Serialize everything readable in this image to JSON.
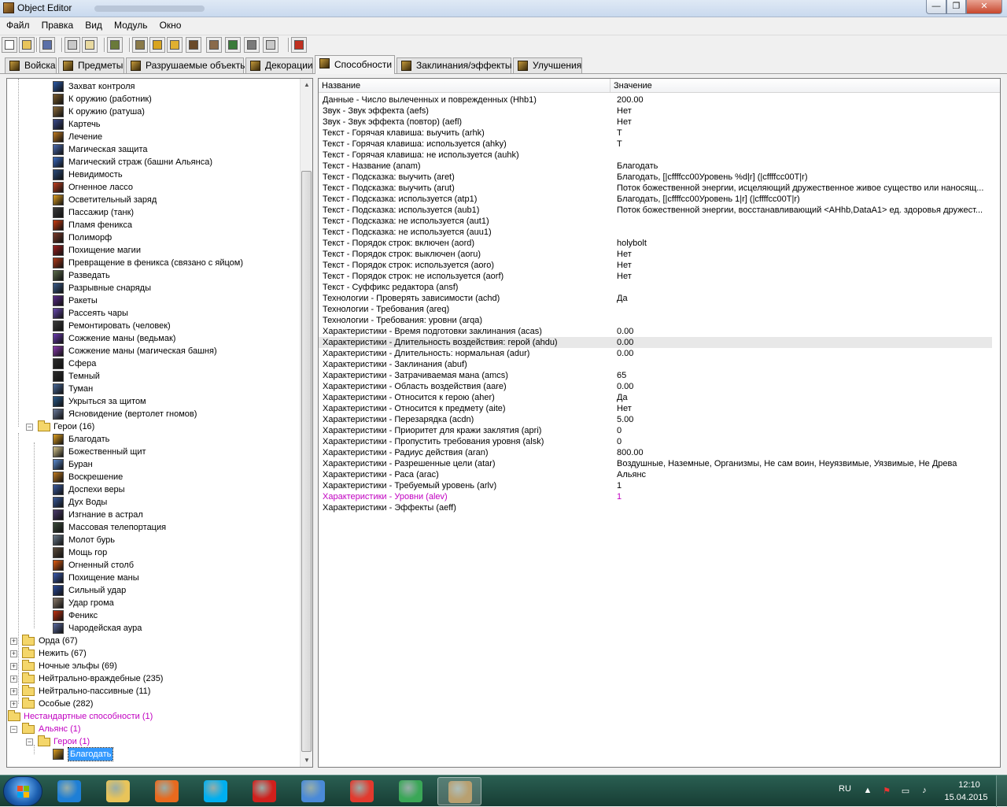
{
  "window": {
    "title": "Object Editor",
    "minimize_glyph": "—",
    "maximize_glyph": "❐",
    "close_glyph": "✕"
  },
  "menu": [
    "Файл",
    "Правка",
    "Вид",
    "Модуль",
    "Окно"
  ],
  "toolbar_icons": [
    "new-icon",
    "open-icon",
    "save-icon",
    "copy-icon",
    "paste-icon",
    "terrain-editor-icon",
    "trigger-editor-icon",
    "text-editor-icon",
    "sound-editor-icon",
    "object-editor-icon",
    "campaign-editor-icon",
    "ai-editor-icon",
    "import-manager-icon",
    "object-manager-icon",
    "test-map-icon"
  ],
  "tabs": [
    {
      "label": "Войска",
      "icon": "units-icon"
    },
    {
      "label": "Предметы",
      "icon": "items-icon"
    },
    {
      "label": "Разрушаемые объекты",
      "icon": "destructibles-icon"
    },
    {
      "label": "Декорации",
      "icon": "doodads-icon"
    },
    {
      "label": "Способности",
      "icon": "abilities-icon",
      "active": true
    },
    {
      "label": "Заклинания/эффекты",
      "icon": "buffs-icon"
    },
    {
      "label": "Улучшения",
      "icon": "upgrades-icon"
    }
  ],
  "tree": {
    "standard_units": [
      "Захват контроля",
      "К оружию (работник)",
      "К оружию (ратуша)",
      "Картечь",
      "Лечение",
      "Магическая защита",
      "Магический страж (башни Альянса)",
      "Невидимость",
      "Огненное лассо",
      "Осветительный заряд",
      "Пассажир (танк)",
      "Пламя феникса",
      "Полиморф",
      "Похищение магии",
      "Превращение в феникса (связано с яйцом)",
      "Разведать",
      "Разрывные снаряды",
      "Ракеты",
      "Рассеять чары",
      "Ремонтировать (человек)",
      "Сожжение маны (ведьмак)",
      "Сожжение маны (магическая башня)",
      "Сфера",
      "Темный",
      "Туман",
      "Укрыться за щитом",
      "Ясновидение (вертолет гномов)"
    ],
    "heroes_folder": "Герои (16)",
    "heroes": [
      "Благодать",
      "Божественный щит",
      "Буран",
      "Воскрешение",
      "Доспехи веры",
      "Дух Воды",
      "Изгнание в астрал",
      "Массовая телепортация",
      "Молот бурь",
      "Мощь гор",
      "Огненный столб",
      "Похищение маны",
      "Сильный удар",
      "Удар грома",
      "Феникс",
      "Чародейская аура"
    ],
    "races": [
      "Орда (67)",
      "Нежить (67)",
      "Ночные эльфы (69)",
      "Нейтрально-враждебные (235)",
      "Нейтрально-пассивные (11)",
      "Особые (282)"
    ],
    "custom_root": "Нестандартные способности (1)",
    "custom_alliance": "Альянс (1)",
    "custom_heroes": "Герои (1)",
    "custom_selected": "Благодать"
  },
  "grid": {
    "col_name": "Название",
    "col_value": "Значение",
    "rows": [
      {
        "name": "Данные - Число вылеченных и поврежденных (Hhb1)",
        "value": "200.00"
      },
      {
        "name": "Звук - Звук эффекта (aefs)",
        "value": "Нет"
      },
      {
        "name": "Звук - Звук эффекта (повтор) (aefl)",
        "value": "Нет"
      },
      {
        "name": "Текст - Горячая клавиша: выучить (arhk)",
        "value": "T"
      },
      {
        "name": "Текст - Горячая клавиша: используется (ahky)",
        "value": "T"
      },
      {
        "name": "Текст - Горячая клавиша: не используется (auhk)",
        "value": ""
      },
      {
        "name": "Текст - Название (anam)",
        "value": "Благодать"
      },
      {
        "name": "Текст - Подсказка: выучить (aret)",
        "value": "Благодать, [|cffffcc00Уровень %d|r] (|cffffcc00T|r)"
      },
      {
        "name": "Текст - Подсказка: выучить (arut)",
        "value": "Поток божественной энергии, исцеляющий дружественное живое существо или наносящ..."
      },
      {
        "name": "Текст - Подсказка: используется (atp1)",
        "value": "Благодать, [|cffffcc00Уровень 1|r] (|cffffcc00T|r)"
      },
      {
        "name": "Текст - Подсказка: используется (aub1)",
        "value": "Поток божественной энергии, восстанавливающий <AHhb,DataA1> ед. здоровья дружест..."
      },
      {
        "name": "Текст - Подсказка: не используется (aut1)",
        "value": ""
      },
      {
        "name": "Текст - Подсказка: не используется (auu1)",
        "value": ""
      },
      {
        "name": "Текст - Порядок строк: включен (aord)",
        "value": "holybolt"
      },
      {
        "name": "Текст - Порядок строк: выключен (aoru)",
        "value": "Нет"
      },
      {
        "name": "Текст - Порядок строк: используется (aoro)",
        "value": "Нет"
      },
      {
        "name": "Текст - Порядок строк: не используется (aorf)",
        "value": "Нет"
      },
      {
        "name": "Текст - Суффикс редактора (ansf)",
        "value": ""
      },
      {
        "name": "Технологии - Проверять зависимости (achd)",
        "value": "Да"
      },
      {
        "name": "Технологии - Требования (areq)",
        "value": ""
      },
      {
        "name": "Технологии - Требования: уровни (arqa)",
        "value": ""
      },
      {
        "name": "Характеристики - Время подготовки заклинания (acas)",
        "value": "0.00"
      },
      {
        "name": "Характеристики - Длительность воздействия: герой (ahdu)",
        "value": "0.00",
        "hover": true
      },
      {
        "name": "Характеристики - Длительность: нормальная (adur)",
        "value": "0.00"
      },
      {
        "name": "Характеристики - Заклинания (abuf)",
        "value": ""
      },
      {
        "name": "Характеристики - Затрачиваемая мана (amcs)",
        "value": "65"
      },
      {
        "name": "Характеристики - Область воздействия (aare)",
        "value": "0.00"
      },
      {
        "name": "Характеристики - Относится к герою (aher)",
        "value": "Да"
      },
      {
        "name": "Характеристики - Относится к предмету (aite)",
        "value": "Нет"
      },
      {
        "name": "Характеристики - Перезарядка (acdn)",
        "value": "5.00"
      },
      {
        "name": "Характеристики - Приоритет для кражи заклятия (apri)",
        "value": "0"
      },
      {
        "name": "Характеристики - Пропустить требования уровня (alsk)",
        "value": "0"
      },
      {
        "name": "Характеристики - Радиус действия (aran)",
        "value": "800.00"
      },
      {
        "name": "Характеристики - Разрешенные цели (atar)",
        "value": "Воздушные, Наземные, Организмы, Не сам воин, Неуязвимые, Уязвимые, Не Древа"
      },
      {
        "name": "Характеристики - Раса (arac)",
        "value": "Альянс"
      },
      {
        "name": "Характеристики - Требуемый уровень (arlv)",
        "value": "1"
      },
      {
        "name": "Характеристики - Уровни (alev)",
        "value": "1",
        "custom": true
      },
      {
        "name": "Характеристики - Эффекты (aeff)",
        "value": ""
      }
    ]
  },
  "taskbar": {
    "apps": [
      {
        "name": "internet-explorer-icon",
        "color": "#1e7fd6"
      },
      {
        "name": "file-explorer-icon",
        "color": "#e8c45a"
      },
      {
        "name": "media-player-icon",
        "color": "#e86a1e"
      },
      {
        "name": "skype-icon",
        "color": "#00aff0"
      },
      {
        "name": "video-app-icon",
        "color": "#d0201c"
      },
      {
        "name": "audio-app-icon",
        "color": "#4a8ad8"
      },
      {
        "name": "yandex-browser-icon",
        "color": "#e23a2e"
      },
      {
        "name": "chrome-icon",
        "color": "#3aa757"
      },
      {
        "name": "world-editor-icon",
        "color": "#b8a070",
        "active": true
      }
    ],
    "lang": "RU",
    "time": "12:10",
    "date": "15.04.2015"
  }
}
